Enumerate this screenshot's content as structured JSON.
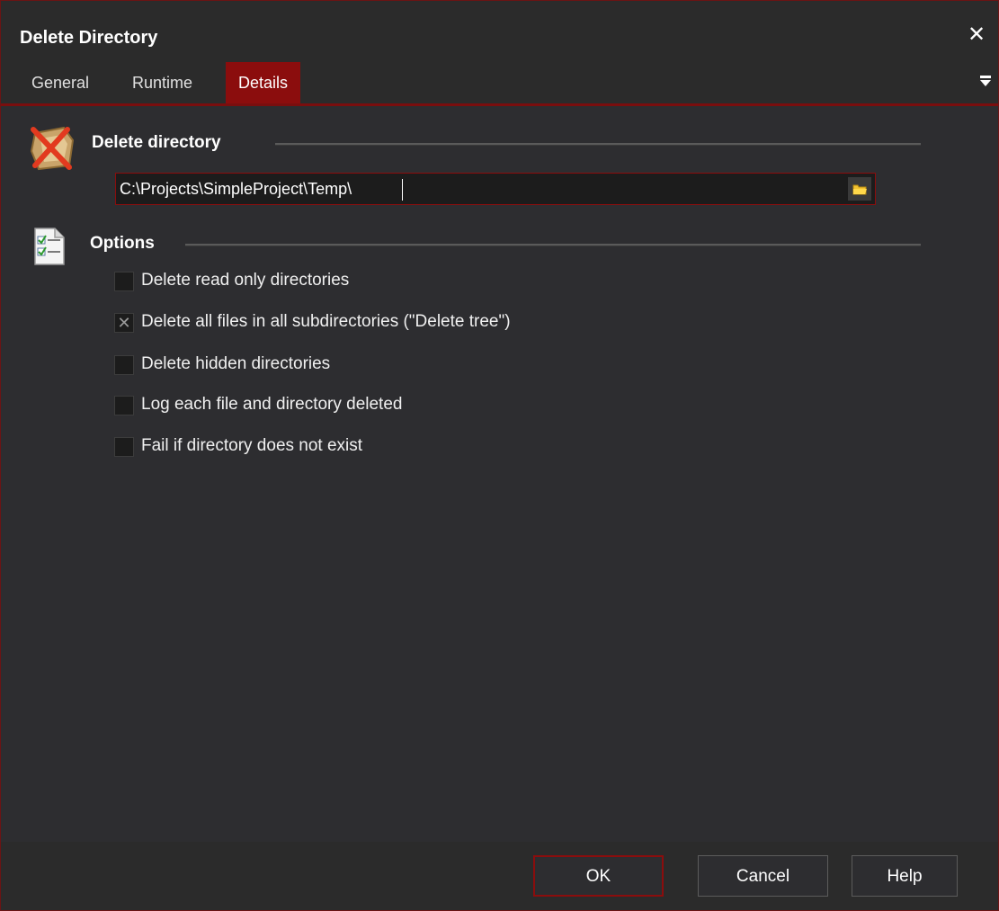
{
  "window": {
    "title": "Delete Directory"
  },
  "tabs": [
    {
      "label": "General"
    },
    {
      "label": "Runtime"
    },
    {
      "label": "Details"
    }
  ],
  "details": {
    "directory_section": {
      "title": "Delete directory",
      "icon": "delete-folder-icon"
    },
    "path_value": "C:\\Projects\\SimpleProject\\Temp\\",
    "options_section": {
      "title": "Options",
      "icon": "checklist-icon"
    },
    "options": [
      {
        "label": "Delete read only directories",
        "checked": false
      },
      {
        "label": "Delete all files in all subdirectories (\"Delete tree\")",
        "checked": true
      },
      {
        "label": "Delete hidden directories",
        "checked": false
      },
      {
        "label": "Log each file and directory deleted",
        "checked": false
      },
      {
        "label": "Fail if directory does not exist",
        "checked": false
      }
    ]
  },
  "footer": {
    "ok_label": "OK",
    "cancel_label": "Cancel",
    "help_label": "Help"
  },
  "colors": {
    "accent": "#8b0d0d",
    "background": "#2d2d30",
    "input_background": "#1c1c1c"
  }
}
